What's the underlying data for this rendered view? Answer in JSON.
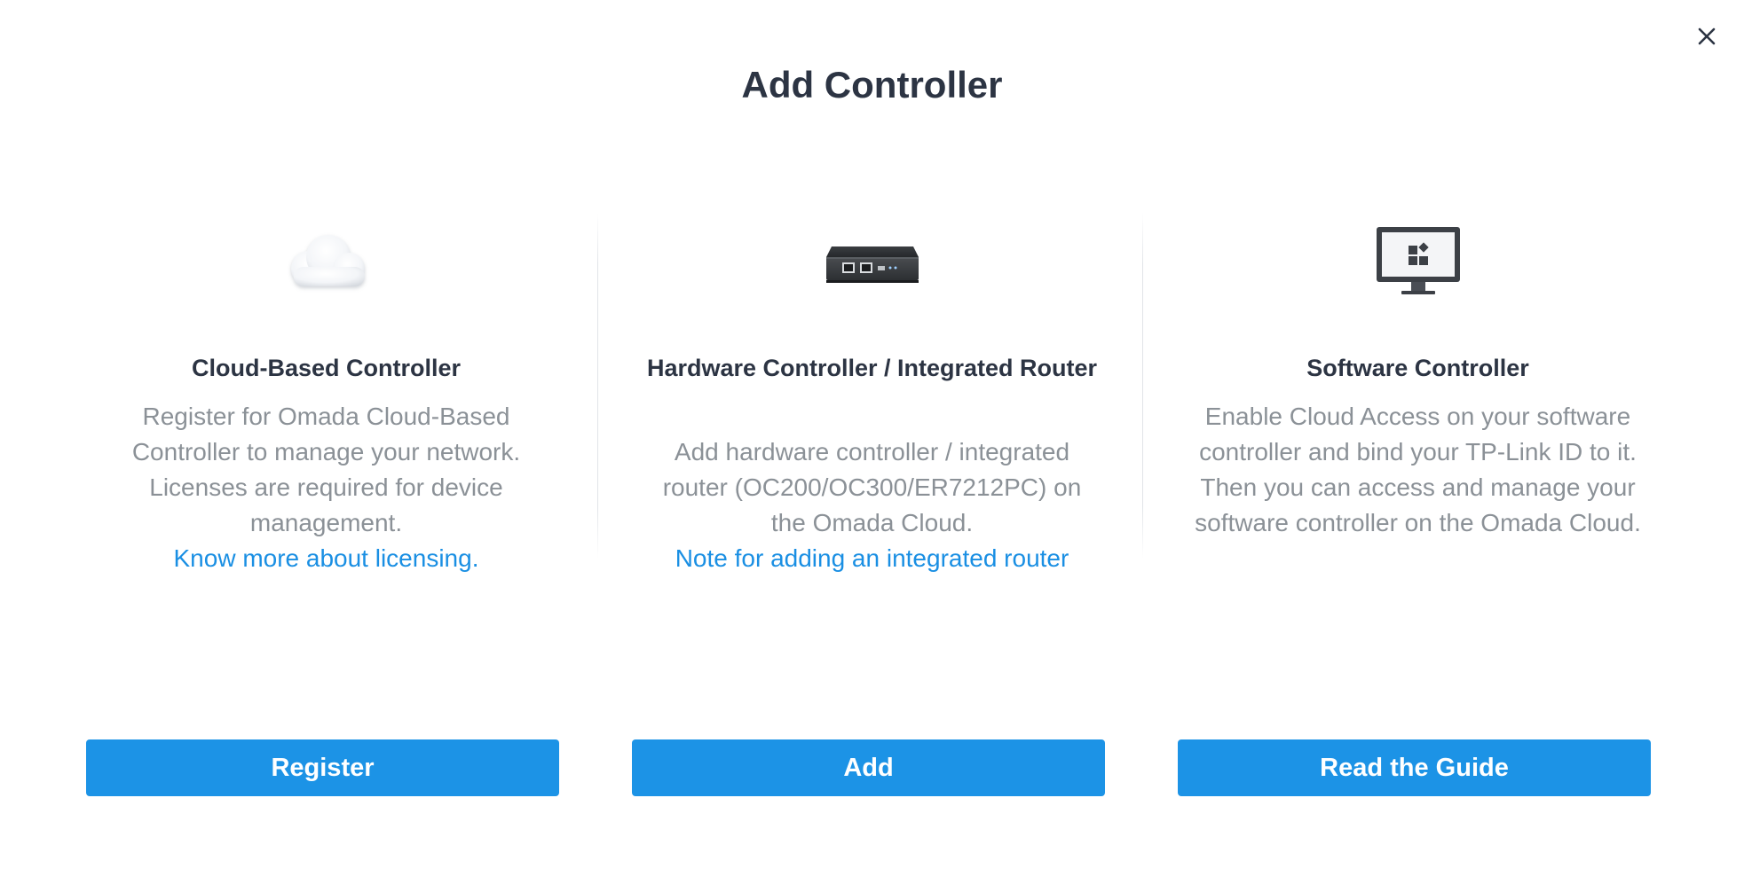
{
  "dialog": {
    "title": "Add Controller"
  },
  "cards": [
    {
      "icon": "cloud-icon",
      "title": "Cloud-Based Controller",
      "description": "Register for Omada Cloud-Based Controller to manage your network. Licenses are required for device management.",
      "link": "Know more about licensing.",
      "button": "Register"
    },
    {
      "icon": "hardware-controller-icon",
      "title": "Hardware Controller / Integrated Router",
      "description": "Add hardware controller / integrated router (OC200/OC300/ER7212PC) on the Omada Cloud.",
      "link": "Note for adding an integrated router",
      "button": "Add"
    },
    {
      "icon": "monitor-icon",
      "title": "Software Controller",
      "description": "Enable Cloud Access on your software controller and bind your TP-Link ID to it. Then you can access and manage your software controller on the Omada Cloud.",
      "button": "Read the Guide"
    }
  ],
  "colors": {
    "primary": "#1c93e6",
    "link": "#1a8fe3",
    "title": "#2c3443",
    "description": "#8b9197"
  }
}
